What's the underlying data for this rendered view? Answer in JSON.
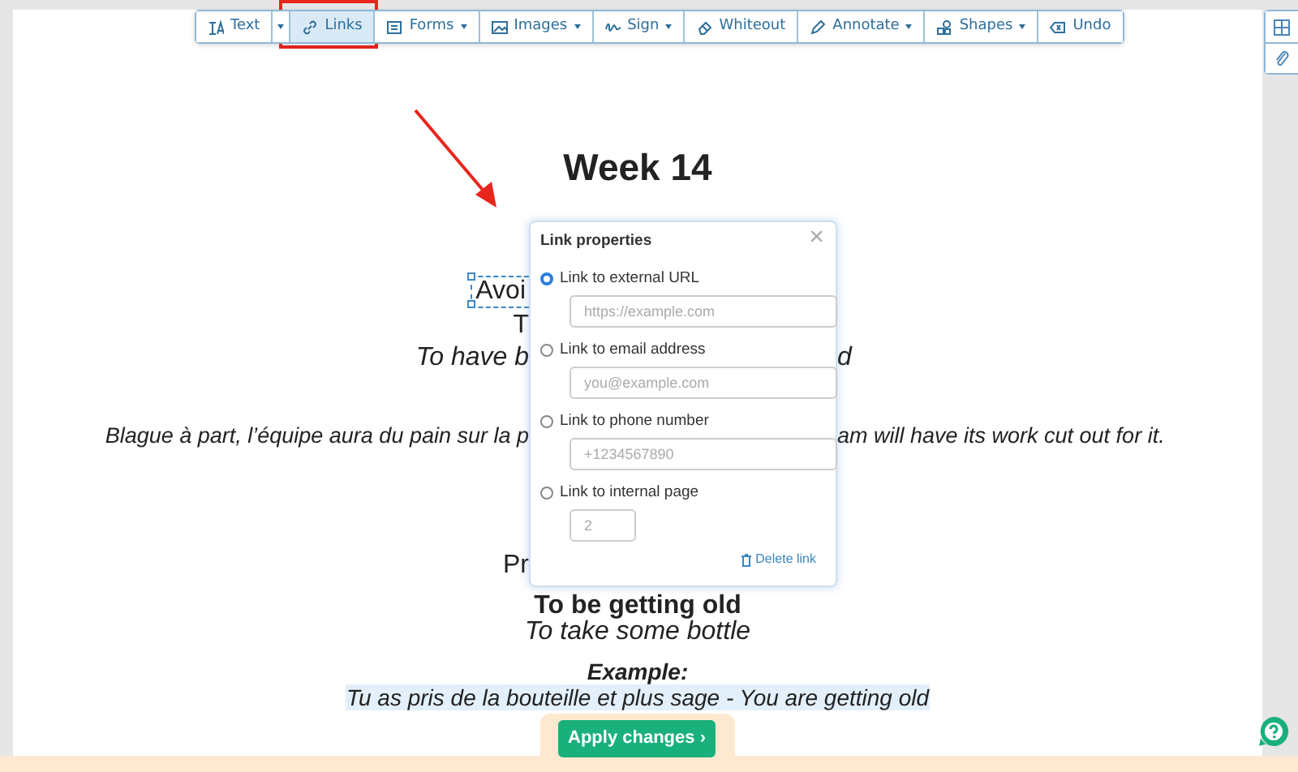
{
  "toolbar": [
    {
      "label": "Text",
      "dropdown": false,
      "selected": false
    },
    {
      "dropdown": true,
      "selected": false
    },
    {
      "label": "Links",
      "dropdown": false,
      "selected": true
    },
    {
      "label": "Forms",
      "dropdown": true,
      "selected": false
    },
    {
      "label": "Images",
      "dropdown": true,
      "selected": false
    },
    {
      "label": "Sign",
      "dropdown": true,
      "selected": false
    },
    {
      "label": "Whiteout",
      "dropdown": false,
      "selected": false
    },
    {
      "label": "Annotate",
      "dropdown": true,
      "selected": false
    },
    {
      "label": "Shapes",
      "dropdown": true,
      "selected": false
    },
    {
      "label": "Undo",
      "dropdown": false,
      "selected": false
    }
  ],
  "document": [
    {
      "kind": "heading",
      "text": "Week 14"
    },
    {
      "kind": "selected",
      "fragments": [
        "Avoi"
      ]
    },
    {
      "kind": "plain",
      "fragments": [
        "T"
      ]
    },
    {
      "kind": "italic",
      "fragments": [
        "To have b",
        "d"
      ]
    },
    {
      "kind": "italic-small",
      "fragments": [
        "Blague à part, l’équipe aura du pain sur la p",
        "am will have its work cut out for it."
      ]
    },
    {
      "kind": "plain",
      "fragments": [
        "Pr"
      ]
    },
    {
      "kind": "bold",
      "text": "To be getting old"
    },
    {
      "kind": "italic",
      "text": "To take some bottle"
    },
    {
      "kind": "bold-italic",
      "text": "Example:"
    },
    {
      "kind": "highlight",
      "text": "Tu as pris de la bouteille et plus sage - You are getting old"
    }
  ],
  "link_properties": {
    "title": "Link properties",
    "close": "×",
    "options": [
      {
        "label": "Link to external URL",
        "selected": true,
        "kind": "text",
        "placeholder": "https://example.com"
      },
      {
        "label": "Link to email address",
        "selected": false,
        "kind": "text",
        "placeholder": "you@example.com"
      },
      {
        "label": "Link to phone number",
        "selected": false,
        "kind": "text",
        "placeholder": "+1234567890"
      },
      {
        "label": "Link to internal page",
        "selected": false,
        "kind": "number",
        "placeholder": "2"
      }
    ],
    "delete": "Delete link"
  },
  "apply_button": "Apply changes ›"
}
